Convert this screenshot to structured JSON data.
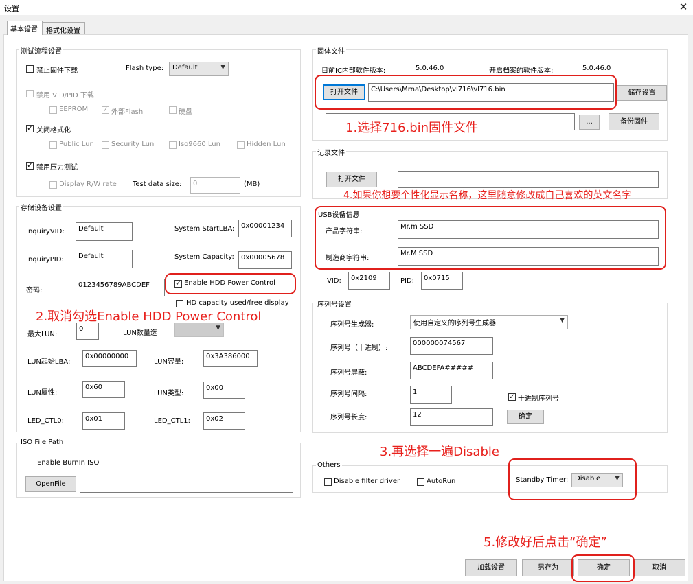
{
  "window": {
    "title": "设置",
    "close_icon": "✕"
  },
  "tabs": [
    {
      "label": "基本设置"
    },
    {
      "label": "格式化设置"
    }
  ],
  "test_flow": {
    "legend": "测试流程设置",
    "disable_fw_download": "禁止固件下载",
    "flash_type_label": "Flash type:",
    "flash_type_value": "Default",
    "disable_vid_pid_download": "禁用 VID/PID 下载",
    "eeprom": "EEPROM",
    "external_flash": "外部Flash",
    "hard_disk": "硬盘",
    "disable_format": "关闭格式化",
    "public_lun": "Public Lun",
    "security_lun": "Security Lun",
    "iso9660_lun": "Iso9660 Lun",
    "hidden_lun": "Hidden Lun",
    "disable_stress_test": "禁用压力测试",
    "display_rw_rate": "Display R/W rate",
    "test_data_size_label": "Test data size:",
    "test_data_size_value": "0",
    "test_data_unit": "(MB)"
  },
  "storage": {
    "legend": "存储设备设置",
    "inquiry_vid_label": "InquiryVID:",
    "inquiry_vid_value": "Default",
    "system_start_lba_label": "System StartLBA:",
    "system_start_lba_value": "0x00001234",
    "inquiry_pid_label": "InquiryPID:",
    "inquiry_pid_value": "Default",
    "system_capacity_label": "System Capacity:",
    "system_capacity_value": "0x00005678",
    "password_label": "密码:",
    "password_value": "0123456789ABCDEF",
    "enable_hdd_power_control": "Enable HDD Power Control",
    "hd_capacity_display": "HD capacity used/free display",
    "max_lun_label": "最大LUN:",
    "max_lun_value": "0",
    "lun_select_label": "LUN数量选",
    "lun_start_lba_label": "LUN起始LBA:",
    "lun_start_lba_value": "0x00000000",
    "lun_capacity_label": "LUN容量:",
    "lun_capacity_value": "0x3A386000",
    "lun_attr_label": "LUN属性:",
    "lun_attr_value": "0x60",
    "lun_type_label": "LUN类型:",
    "lun_type_value": "0x00",
    "led_ctl0_label": "LED_CTL0:",
    "led_ctl0_value": "0x01",
    "led_ctl1_label": "LED_CTL1:",
    "led_ctl1_value": "0x02"
  },
  "iso": {
    "legend": "ISO File Path",
    "enable_burnin_iso": "Enable BurnIn ISO",
    "open_file_button": "OpenFile",
    "path_value": ""
  },
  "firmware": {
    "legend": "固体文件",
    "current_ic_version_label": "目前IC内部软件版本:",
    "current_ic_version_value": "5.0.46.0",
    "opened_file_version_label": "开启档案的软件版本:",
    "opened_file_version_value": "5.0.46.0",
    "open_file_button": "打开文件",
    "file_path": "C:\\Users\\Mrna\\Desktop\\vl716\\vl716.bin",
    "save_settings_button": "储存设置",
    "backup_path": "",
    "browse_button": "...",
    "backup_firmware_button": "备份固件"
  },
  "log": {
    "legend": "记录文件",
    "open_file_button": "打开文件",
    "path_value": ""
  },
  "usb": {
    "legend": "USB设备信息",
    "product_string_label": "产品字符串:",
    "product_string_value": "Mr.m SSD",
    "manufacturer_string_label": "制造商字符串:",
    "manufacturer_string_value": "Mr.M SSD",
    "vid_label": "VID:",
    "vid_value": "0x2109",
    "pid_label": "PID:",
    "pid_value": "0x0715"
  },
  "serial": {
    "legend": "序列号设置",
    "generator_label": "序列号生成器:",
    "generator_value": "使用自定义的序列号生成器",
    "serial_decimal_label": "序列号（十进制）:",
    "serial_decimal_value": "000000074567",
    "serial_mask_label": "序列号屏蔽:",
    "serial_mask_value": "ABCDEFA#####",
    "serial_interval_label": "序列号间隔:",
    "serial_interval_value": "1",
    "decimal_serial_checkbox": "十进制序列号",
    "serial_length_label": "序列号长度:",
    "serial_length_value": "12",
    "confirm_button": "确定"
  },
  "others": {
    "legend": "Others",
    "disable_filter_driver": "Disable filter driver",
    "autorun": "AutoRun",
    "standby_timer_label": "Standby Timer:",
    "standby_timer_value": "Disable"
  },
  "footer": {
    "load_settings": "加载设置",
    "save_as": "另存为",
    "ok": "确定",
    "cancel": "取消"
  },
  "annotations": {
    "step1": "1.选择716.bin固件文件",
    "step2": "2.取消勾选Enable HDD Power Control",
    "step3": "3.再选择一遍Disable",
    "step4": "4.如果你想要个性化显示名称，这里随意修改成自己喜欢的英文名字",
    "step5": "5.修改好后点击“确定”"
  },
  "checks": {
    "checked_mark": "✓"
  },
  "colors": {
    "annotation_red": "#e8201c",
    "focus_blue": "#0078d7",
    "panel_white": "#ffffff",
    "window_bg": "#f0f0f0"
  }
}
